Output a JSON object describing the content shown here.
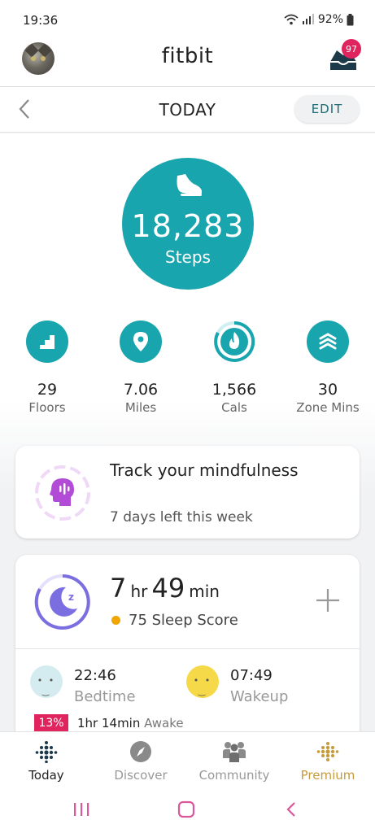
{
  "status_bar": {
    "time": "19:36",
    "battery": "92%"
  },
  "header": {
    "app_title": "fitbit",
    "inbox_count": "97"
  },
  "date_bar": {
    "title": "TODAY",
    "edit_label": "EDIT"
  },
  "steps": {
    "value": "18,283",
    "label": "Steps"
  },
  "stats": [
    {
      "value": "29",
      "label": "Floors",
      "icon": "stairs-icon"
    },
    {
      "value": "7.06",
      "label": "Miles",
      "icon": "location-pin-icon"
    },
    {
      "value": "1,566",
      "label": "Cals",
      "icon": "flame-icon"
    },
    {
      "value": "30",
      "label": "Zone Mins",
      "icon": "zone-chevrons-icon"
    }
  ],
  "mindfulness": {
    "title": "Track your mindfulness",
    "subtitle": "7 days left this week"
  },
  "sleep": {
    "hours": "7",
    "hours_unit": "hr",
    "minutes": "49",
    "minutes_unit": "min",
    "score_text": "75 Sleep Score",
    "bedtime": "22:46",
    "bedtime_label": "Bedtime",
    "wakeup": "07:49",
    "wakeup_label": "Wakeup",
    "awake_pct": "13%",
    "awake_duration": "1hr 14min",
    "awake_label": "Awake"
  },
  "bottom_nav": [
    {
      "label": "Today",
      "icon": "today-dots-icon"
    },
    {
      "label": "Discover",
      "icon": "compass-icon"
    },
    {
      "label": "Community",
      "icon": "community-icon"
    },
    {
      "label": "Premium",
      "icon": "premium-dots-icon"
    }
  ],
  "colors": {
    "teal": "#18a5ad",
    "badge": "#e0245e",
    "mindfulness": "#b24bd6",
    "sleep": "#7b6ee0",
    "premium": "#c79a3a"
  }
}
